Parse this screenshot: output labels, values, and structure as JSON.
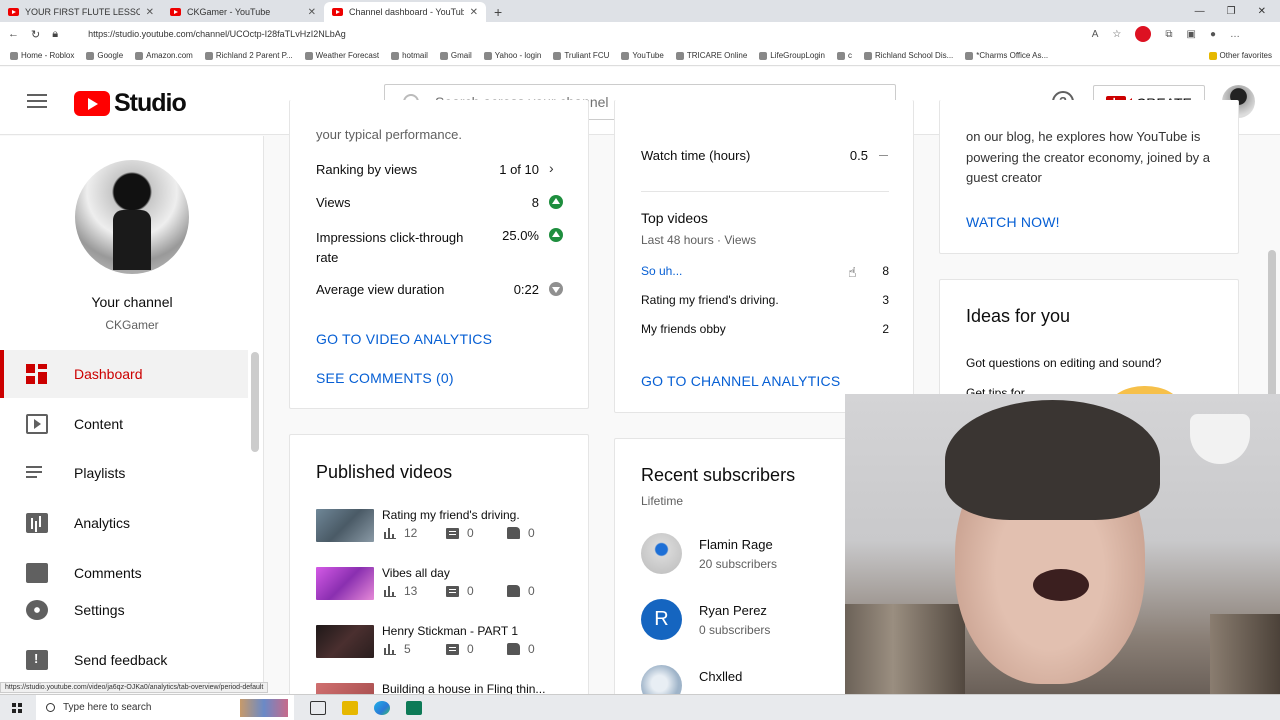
{
  "browser": {
    "tabs": [
      {
        "title": "YOUR FIRST FLUTE LESSON | The...",
        "active": false
      },
      {
        "title": "CKGamer - YouTube",
        "active": false
      },
      {
        "title": "Channel dashboard - YouTube St...",
        "active": true
      }
    ],
    "url": "https://studio.youtube.com/channel/UCOctp-I28faTLvHzI2NLbAg",
    "bookmarks": [
      "Home - Roblox",
      "Google",
      "Amazon.com",
      "Richland 2 Parent P...",
      "Weather Forecast",
      "hotmail",
      "Gmail",
      "Yahoo - login",
      "Truliant FCU",
      "YouTube",
      "TRICARE Online",
      "LifeGroupLogin",
      "c",
      "Richland School Dis...",
      "*Charms Office As..."
    ],
    "other_favorites": "Other favorites",
    "status_url": "https://studio.youtube.com/video/ja6qz-OJKa0/analytics/tab-overview/period-default"
  },
  "header": {
    "logo_text": "Studio",
    "search_placeholder": "Search across your channel",
    "help_glyph": "?",
    "create_label": "CREATE"
  },
  "sidebar": {
    "channel_title": "Your channel",
    "channel_name": "CKGamer",
    "items": [
      {
        "label": "Dashboard",
        "icon": "dashboard-icon",
        "active": true
      },
      {
        "label": "Content",
        "icon": "content-icon"
      },
      {
        "label": "Playlists",
        "icon": "playlists-icon"
      },
      {
        "label": "Analytics",
        "icon": "analytics-icon"
      },
      {
        "label": "Comments",
        "icon": "comments-icon"
      },
      {
        "label": "Settings",
        "icon": "gear-icon"
      },
      {
        "label": "Send feedback",
        "icon": "feedback-icon"
      }
    ]
  },
  "latest_video": {
    "cut_text": "your typical performance.",
    "metrics": [
      {
        "label": "Ranking by views",
        "value": "1 of 10",
        "indicator": "chevron"
      },
      {
        "label": "Views",
        "value": "8",
        "indicator": "up"
      },
      {
        "label": "Impressions click-through rate",
        "value": "25.0%",
        "indicator": "up"
      },
      {
        "label": "Average view duration",
        "value": "0:22",
        "indicator": "down"
      }
    ],
    "go_to_video_analytics": "GO TO VIDEO ANALYTICS",
    "see_comments": "SEE COMMENTS (0)"
  },
  "channel_analytics": {
    "watch_time_label": "Watch time (hours)",
    "watch_time_value": "0.5",
    "top_videos_title": "Top videos",
    "top_videos_sub": "Last 48 hours · Views",
    "top_videos": [
      {
        "title": "So uh...",
        "views": "8"
      },
      {
        "title": "Rating my friend's driving.",
        "views": "3"
      },
      {
        "title": "My friends obby",
        "views": "2"
      }
    ],
    "go_to_channel_analytics": "GO TO CHANNEL ANALYTICS"
  },
  "news": {
    "text": "on our blog, he explores how YouTube is powering the creator economy, joined by a guest creator",
    "watch_now": "WATCH NOW!"
  },
  "ideas": {
    "title": "Ideas for you",
    "question": "Got questions on editing and sound?",
    "cut_text": "Get tips for"
  },
  "published_videos": {
    "title": "Published videos",
    "videos": [
      {
        "title": "Rating my friend's driving.",
        "views": "12",
        "comments": "0",
        "likes": "0",
        "thumb": "#5a6b7a"
      },
      {
        "title": "Vibes all day",
        "views": "13",
        "comments": "0",
        "likes": "0",
        "thumb": "#b04ad0"
      },
      {
        "title": "Henry Stickman - PART 1",
        "views": "5",
        "comments": "0",
        "likes": "0",
        "thumb": "#3a2b2b"
      },
      {
        "title": "Building a house in Fling thin...",
        "views": "",
        "comments": "",
        "likes": "",
        "thumb": "#c46a6a"
      }
    ]
  },
  "recent_subscribers": {
    "title": "Recent subscribers",
    "sub": "Lifetime",
    "items": [
      {
        "name": "Flamin Rage",
        "count": "20 subscribers",
        "avatar_color": "#c8c8c8"
      },
      {
        "name": "Ryan Perez",
        "count": "0 subscribers",
        "avatar_color": "#1565c0",
        "initial": "R"
      },
      {
        "name": "Chxlled",
        "count": "",
        "avatar_color": "#9fb4c9"
      }
    ]
  },
  "taskbar": {
    "search_placeholder": "Type here to search"
  },
  "colors": {
    "brand_red": "#ff0000",
    "link_blue": "#065fd4",
    "up_green": "#1e8e3e"
  }
}
